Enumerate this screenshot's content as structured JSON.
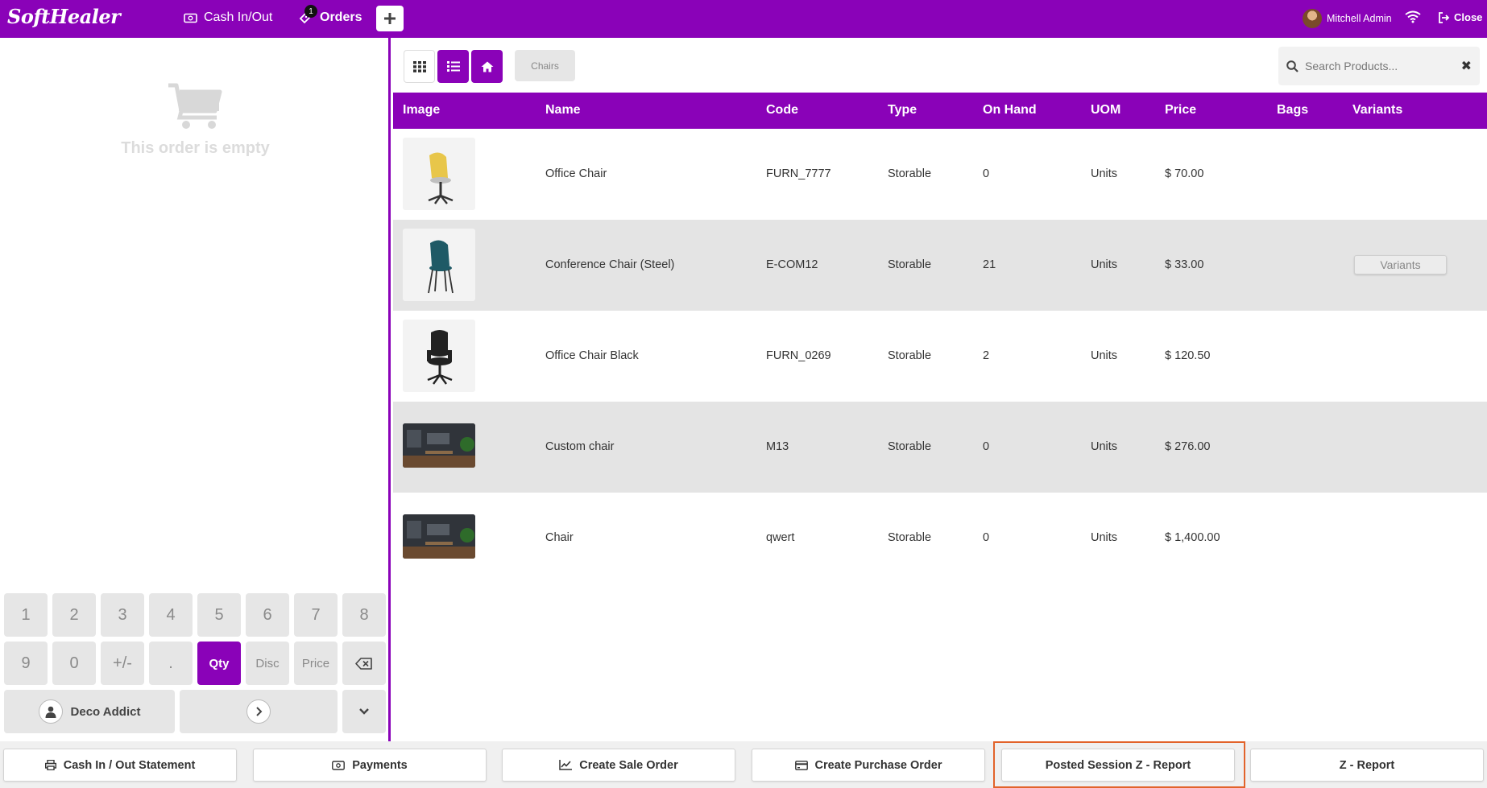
{
  "app": {
    "logo_text": "SoftHealer",
    "brand_color": "#8a02b8",
    "highlight_color": "#e2632b"
  },
  "topbar": {
    "cash_label": "Cash In/Out",
    "orders_label": "Orders",
    "orders_badge": "1",
    "add_icon": "plus-icon",
    "user_name": "Mitchell Admin",
    "close_label": "Close"
  },
  "order": {
    "empty_text": "This order is empty"
  },
  "numpad": {
    "keys": [
      "1",
      "2",
      "3",
      "4",
      "5",
      "6",
      "7",
      "8",
      "9",
      "0",
      "+/-",
      ".",
      "Qty",
      "Disc",
      "Price"
    ],
    "active_mode": "Qty",
    "customer_label": "Deco Addict"
  },
  "products": {
    "category_chip": "Chairs",
    "search_placeholder": "Search Products...",
    "columns": {
      "image": "Image",
      "name": "Name",
      "code": "Code",
      "type": "Type",
      "on_hand": "On Hand",
      "uom": "UOM",
      "price": "Price",
      "bags": "Bags",
      "variants": "Variants"
    },
    "rows": [
      {
        "name": "Office Chair",
        "code": "FURN_7777",
        "type": "Storable",
        "on_hand": "0",
        "uom": "Units",
        "price": "$ 70.00",
        "variants_label": ""
      },
      {
        "name": "Conference Chair (Steel)",
        "code": "E-COM12",
        "type": "Storable",
        "on_hand": "21",
        "uom": "Units",
        "price": "$ 33.00",
        "variants_label": "Variants"
      },
      {
        "name": "Office Chair Black",
        "code": "FURN_0269",
        "type": "Storable",
        "on_hand": "2",
        "uom": "Units",
        "price": "$ 120.50",
        "variants_label": ""
      },
      {
        "name": "Custom chair",
        "code": "M13",
        "type": "Storable",
        "on_hand": "0",
        "uom": "Units",
        "price": "$ 276.00",
        "variants_label": ""
      },
      {
        "name": "Chair",
        "code": "qwert",
        "type": "Storable",
        "on_hand": "0",
        "uom": "Units",
        "price": "$ 1,400.00",
        "variants_label": ""
      }
    ]
  },
  "bottombar": {
    "cash_statement": "Cash In / Out Statement",
    "payments": "Payments",
    "create_sale_order": "Create Sale Order",
    "create_purchase_order": "Create Purchase Order",
    "posted_z_report": "Posted Session Z - Report",
    "z_report": "Z - Report"
  }
}
